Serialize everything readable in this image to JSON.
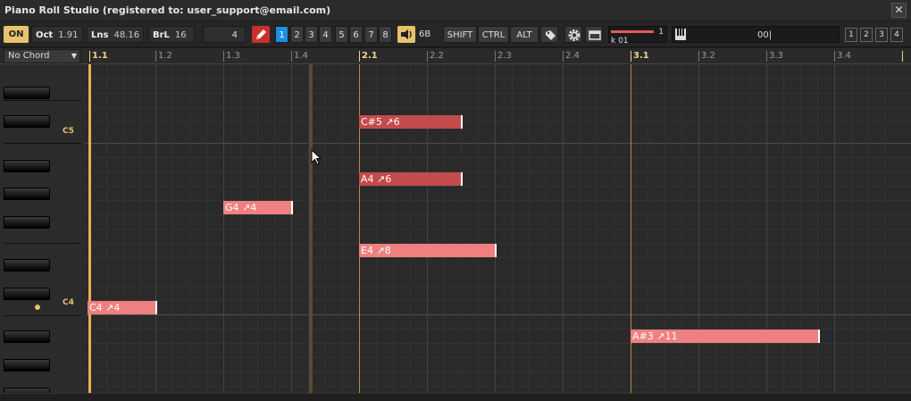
{
  "window": {
    "title": "Piano Roll Studio  (registered to: user_support@email.com)",
    "close": "✕"
  },
  "toolbar": {
    "on": "ON",
    "oct_label": "Oct",
    "oct_value": "1.91",
    "lns_label": "Lns",
    "lns_value": "48.16",
    "brl_label": "BrL",
    "brl_value": "16",
    "snap_value": "4",
    "layers": [
      "1",
      "2",
      "3",
      "4",
      "5",
      "6",
      "7",
      "8"
    ],
    "active_layer": "1",
    "sound_value": "6B",
    "shift": "SHIFT",
    "ctrl": "CTRL",
    "alt": "ALT",
    "slider_value": "1",
    "slider_label": "k 01",
    "keyboard_text": "00|",
    "pages": [
      "1",
      "2",
      "3",
      "4"
    ],
    "icons": {
      "pencil": "pencil-icon",
      "speaker": "speaker-icon",
      "tag": "tag-icon",
      "gear": "gear-icon",
      "window": "window-icon",
      "piano": "piano-icon"
    }
  },
  "ruler": {
    "chord": "No Chord",
    "ticks": [
      "1.1",
      "1.2",
      "1.3",
      "1.4",
      "2.1",
      "2.2",
      "2.3",
      "2.4",
      "3.1",
      "3.2",
      "3.3",
      "3.4"
    ]
  },
  "keys": {
    "labels": [
      "C5",
      "C4"
    ]
  },
  "notes": [
    {
      "label": "C#5 ↗6",
      "pitch": "C#5",
      "velocity": 6,
      "start": 2.1,
      "selected": true
    },
    {
      "label": "A4 ↗6",
      "pitch": "A4",
      "velocity": 6,
      "start": 2.1,
      "selected": true
    },
    {
      "label": "G4 ↗4",
      "pitch": "G4",
      "velocity": 4,
      "start": 1.3,
      "selected": false
    },
    {
      "label": "E4 ↗8",
      "pitch": "E4",
      "velocity": 8,
      "start": 2.1,
      "selected": false
    },
    {
      "label": "C4 ↗4",
      "pitch": "C4",
      "velocity": 4,
      "start": 1.1,
      "selected": false
    },
    {
      "label": "A#3 ↗11",
      "pitch": "A#3",
      "velocity": 11,
      "start": 3.1,
      "selected": false
    }
  ],
  "colors": {
    "accent": "#e8c26c",
    "active_layer": "#1e8fe6",
    "selected_note": "#c44b4b",
    "note": "#f08080",
    "bar_line": "#b88a3c"
  }
}
